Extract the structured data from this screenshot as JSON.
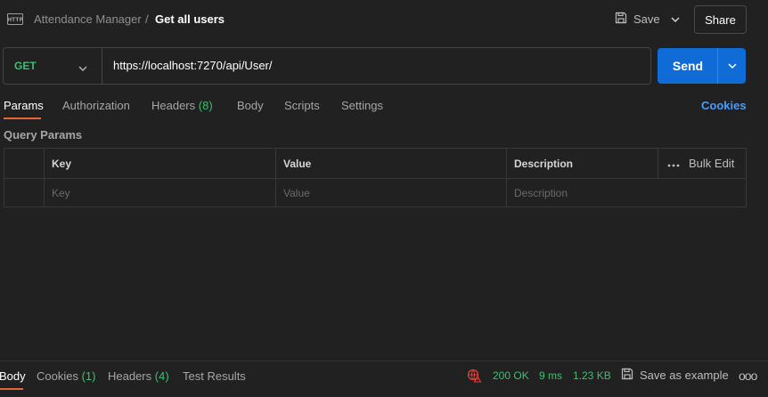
{
  "header": {
    "breadcrumb_parent": "Attendance Manager",
    "breadcrumb_sep": "/",
    "title": "Get all users",
    "save_label": "Save",
    "share_label": "Share"
  },
  "request": {
    "method": "GET",
    "url": "https://localhost:7270/api/User/",
    "send_label": "Send"
  },
  "tabs": [
    {
      "label": "Params",
      "active": true
    },
    {
      "label": "Authorization"
    },
    {
      "label": "Headers",
      "count": "(8)"
    },
    {
      "label": "Body"
    },
    {
      "label": "Scripts"
    },
    {
      "label": "Settings"
    }
  ],
  "cookies_label": "Cookies",
  "query_params": {
    "title": "Query Params",
    "columns": [
      "Key",
      "Value",
      "Description"
    ],
    "bulk_edit": "Bulk Edit",
    "more": "•••",
    "placeholders": {
      "key": "Key",
      "value": "Value",
      "description": "Description"
    }
  },
  "response": {
    "tabs": [
      {
        "label": "Body",
        "active": true
      },
      {
        "label": "Cookies",
        "count": "(1)"
      },
      {
        "label": "Headers",
        "count": "(4)"
      },
      {
        "label": "Test Results"
      }
    ],
    "status": "200 OK",
    "time": "9 ms",
    "size": "1.23 KB",
    "save_example": "Save as example",
    "more": "ooo"
  },
  "colors": {
    "accent": "#e8643a",
    "send": "#0f6cd6",
    "success": "#3fbf6f",
    "link": "#4c9bf7",
    "error_icon": "#e0413a"
  },
  "icons": [
    "http-icon",
    "save-icon",
    "chevron-down-icon",
    "globe-error-icon",
    "save-example-icon",
    "more-icon"
  ]
}
